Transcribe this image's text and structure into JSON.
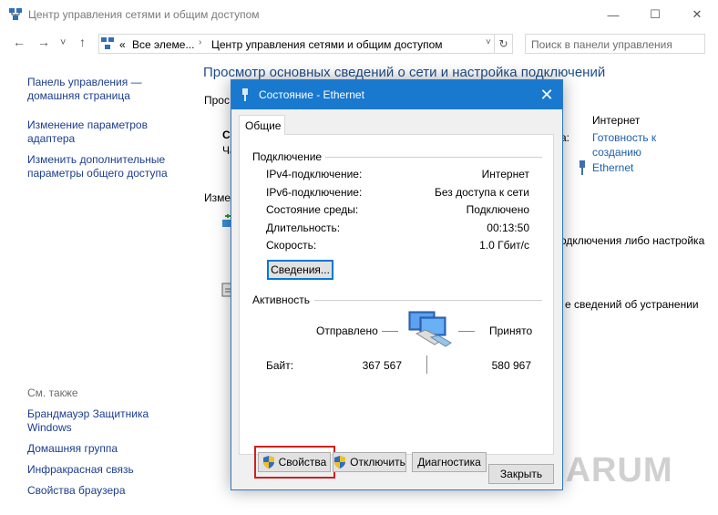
{
  "window": {
    "title": "Центр управления сетями и общим доступом",
    "minimize_glyph": "—",
    "maximize_glyph": "☐",
    "close_glyph": "✕"
  },
  "nav": {
    "back_glyph": "←",
    "forward_glyph": "→",
    "dropdown_glyph": "˅",
    "up_glyph": "↑",
    "breadcrumb_prefix": "«",
    "breadcrumb_1": "Все элеме...",
    "breadcrumb_2": "Центр управления сетями и общим доступом",
    "chevron": "›",
    "refresh_glyph": "↻",
    "search_placeholder": "Поиск в панели управления"
  },
  "sidebar": {
    "items": [
      {
        "line1": "Панель управления —",
        "line2": "домашняя страница"
      },
      {
        "line1": "Изменение параметров",
        "line2": "адаптера"
      },
      {
        "line1": "Изменить дополнительные",
        "line2": "параметры общего доступа"
      }
    ],
    "see_also": "См. также",
    "see_also_items": [
      {
        "line1": "Брандмауэр Защитника",
        "line2": "Windows"
      },
      {
        "line1": "Домашняя группа",
        "line2": ""
      },
      {
        "line1": "Инфракрасная связь",
        "line2": ""
      },
      {
        "line1": "Свойства браузера",
        "line2": ""
      }
    ]
  },
  "main": {
    "title": "Просмотр основных сведений о сети и настройка подключений",
    "partial_view": "Прос",
    "partial_net": "Сеть",
    "partial_private": "Ча",
    "partial_change": "Изме",
    "internet_label": "Интернет",
    "colon": "а:",
    "homegroup_link_1": "Готовность к",
    "homegroup_link_2": "созданию",
    "connection_link": "Ethernet",
    "setup_text": "одключения либо настройка",
    "troubleshoot_text": "е сведений об устранении"
  },
  "dialog": {
    "title": "Состояние - Ethernet",
    "close_glyph": "✕",
    "tab": "Общие",
    "connection": {
      "header": "Подключение",
      "rows": [
        {
          "label": "IPv4-подключение:",
          "value": "Интернет"
        },
        {
          "label": "IPv6-подключение:",
          "value": "Без доступа к сети"
        },
        {
          "label": "Состояние среды:",
          "value": "Подключено"
        },
        {
          "label": "Длительность:",
          "value": "00:13:50"
        },
        {
          "label": "Скорость:",
          "value": "1.0 Гбит/с"
        }
      ],
      "details_button": "Сведения..."
    },
    "activity": {
      "header": "Активность",
      "sent_label": "Отправлено",
      "received_label": "Принято",
      "bytes_label": "Байт:",
      "sent_bytes": "367 567",
      "received_bytes": "580 967"
    },
    "buttons": {
      "properties": "Свойства",
      "disable": "Отключить",
      "diagnose": "Диагностика",
      "close": "Закрыть"
    }
  },
  "watermark": "VIARUM",
  "colors": {
    "dialog_titlebar": "#1979cf",
    "link": "#1c3e8e",
    "highlight": "#d21f1f"
  }
}
